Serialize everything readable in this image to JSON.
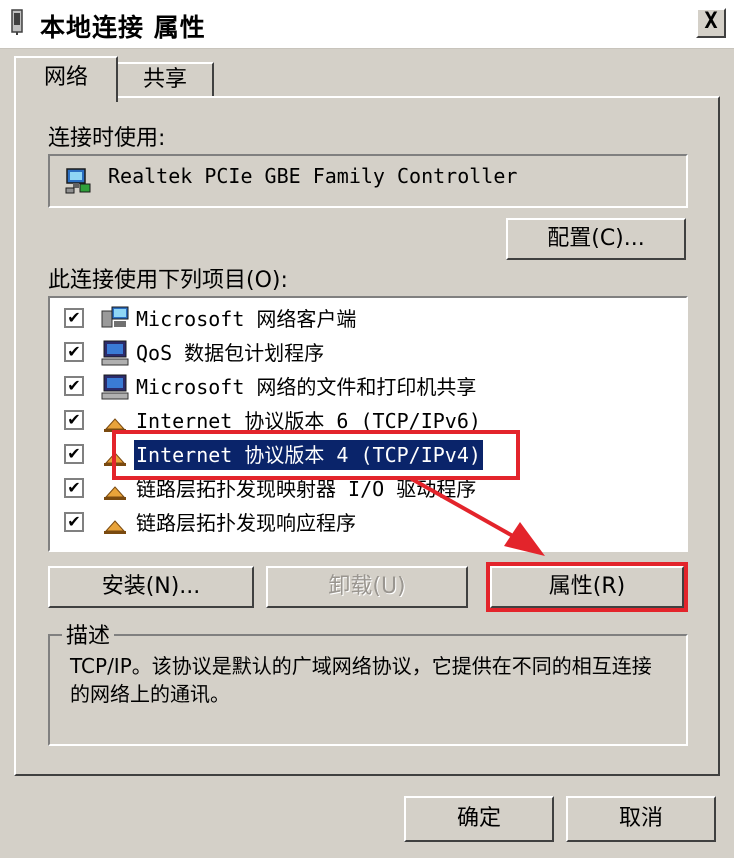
{
  "window": {
    "title": "本地连接 属性",
    "close_label": "X"
  },
  "tabs": [
    {
      "label": "网络",
      "active": true
    },
    {
      "label": "共享",
      "active": false
    }
  ],
  "connect_using": {
    "label": "连接时使用:",
    "adapter": "Realtek PCIe GBE Family Controller",
    "configure_button": "配置(C)..."
  },
  "items": {
    "label": "此连接使用下列项目(O):",
    "list": [
      {
        "label": "Microsoft 网络客户端",
        "checked": true,
        "icon": "network-client-icon"
      },
      {
        "label": "QoS 数据包计划程序",
        "checked": true,
        "icon": "computer-icon"
      },
      {
        "label": "Microsoft 网络的文件和打印机共享",
        "checked": true,
        "icon": "computer-icon"
      },
      {
        "label": "Internet 协议版本 6 (TCP/IPv6)",
        "checked": true,
        "icon": "protocol-icon"
      },
      {
        "label": "Internet 协议版本 4 (TCP/IPv4)",
        "checked": true,
        "icon": "protocol-icon",
        "selected": true
      },
      {
        "label": "链路层拓扑发现映射器 I/O 驱动程序",
        "checked": true,
        "icon": "protocol-icon"
      },
      {
        "label": "链路层拓扑发现响应程序",
        "checked": true,
        "icon": "protocol-icon"
      }
    ]
  },
  "buttons": {
    "install": "安装(N)...",
    "uninstall": "卸载(U)",
    "properties": "属性(R)",
    "ok": "确定",
    "cancel": "取消"
  },
  "description": {
    "legend": "描述",
    "text": "TCP/IP。该协议是默认的广域网络协议，它提供在不同的相互连接的网络上的通讯。"
  },
  "check_mark": "✔",
  "colors": {
    "dialog_bg": "#d4d0c8",
    "selection_bg": "#0a246a",
    "annotation_red": "#e3242b"
  }
}
